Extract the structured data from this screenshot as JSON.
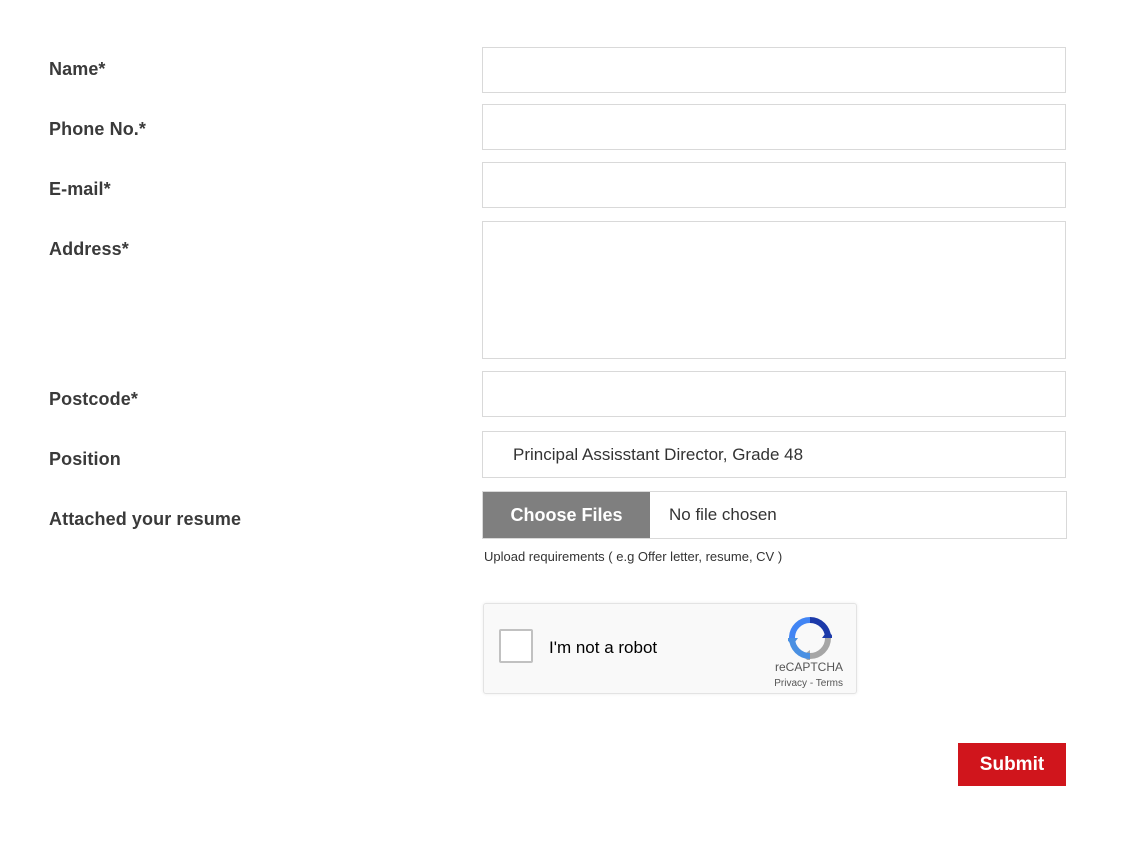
{
  "form": {
    "name_label": "Name*",
    "phone_label": "Phone No.*",
    "email_label": "E-mail*",
    "address_label": "Address*",
    "postcode_label": "Postcode*",
    "position_label": "Position",
    "position_value": "Principal Assisstant Director, Grade 48",
    "resume_label": "Attached your resume",
    "choose_files_label": "Choose Files",
    "no_file_text": "No file chosen",
    "upload_help": "Upload requirements ( e.g Offer letter, resume, CV )",
    "submit_label": "Submit"
  },
  "captcha": {
    "checkbox_label": "I'm not a robot",
    "brand": "reCAPTCHA",
    "privacy": "Privacy",
    "separator": " - ",
    "terms": "Terms"
  },
  "colors": {
    "submit_bg": "#d0151c",
    "choose_btn_bg": "#7f7f7f"
  }
}
